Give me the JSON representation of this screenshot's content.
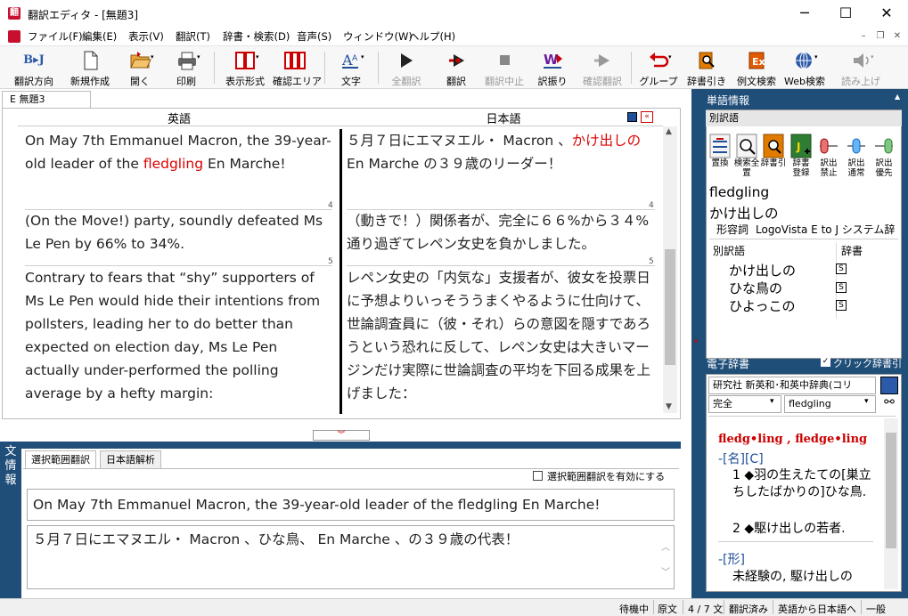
{
  "window": {
    "title": "翻訳エディタ - [無題3]",
    "app_icon_text": "翻"
  },
  "menu": [
    "ファイル(F)",
    "編集(E)",
    "表示(V)",
    "翻訳(T)",
    "辞書・検索(D)",
    "音声(S)",
    "ウィンドウ(W)",
    "ヘルプ(H)"
  ],
  "toolbar": {
    "translate_direction": "翻訳方向",
    "new": "新規作成",
    "open": "開く",
    "print": "印刷",
    "display_format": "表示形式",
    "confirm_area": "確認エリア",
    "characters": "文字",
    "translate_all": "全翻訳",
    "translate": "翻訳",
    "translate_stop": "翻訳中止",
    "furigana": "訳振り",
    "confirm_translate": "確認翻訳",
    "group": "グループ",
    "dict_lookup": "辞書引き",
    "example_search": "例文検索",
    "web_search": "Web検索",
    "read_aloud": "読み上げ",
    "bj_icon": "B▸J"
  },
  "document": {
    "tab_label": "E 無題3",
    "col_english": "英語",
    "col_japanese": "日本語",
    "rows": [
      {
        "en_pre": "On May 7th Emmanuel Macron, the 39-year-old leader of the ",
        "en_hl": "fledgling",
        "en_post": " En Marche!",
        "ja_pre": "５月７日にエマヌエル・ Macron 、",
        "ja_hl": "かけ出しの",
        "ja_post": " En Marche の３９歳のリーダー！",
        "num": "4"
      },
      {
        "en": "(On the Move!) party, soundly defeated Ms Le Pen by 66% to 34%.",
        "ja": "（動きで！）関係者が、完全に６６%から３４%通り過ぎてレペン女史を負かしました。",
        "num": "5"
      },
      {
        "en": "Contrary to fears that “shy” supporters of Ms Le Pen would hide their intentions from pollsters, leading her to do better than expected on election day, Ms Le Pen actually under-performed the polling average by a hefty margin:",
        "ja": "レペン女史の「内気な」支援者が、彼女を投票日に予想よりいっそううまくやるように仕向けて、世論調査員に（彼・それ）らの意図を隠すであろうという恐れに反して、レペン女史は大きいマージンだけ実際に世論調査の平均を下回る成果を上げました：",
        "num": "5"
      }
    ]
  },
  "bottom": {
    "side_label": "文情報",
    "tab_selection": "選択範囲翻訳",
    "tab_japanese": "日本語解析",
    "enable_checkbox": "選択範囲翻訳を有効にする",
    "source": "On May 7th Emmanuel Macron, the 39-year-old leader of the fledgling En Marche!",
    "target": "５月７日にエマヌエル・ Macron 、ひな鳥、 En Marche 、の３９歳の代表！"
  },
  "word_info": {
    "title": "単語情報",
    "section": "別訳語",
    "tools": [
      "置換",
      "検索全置",
      "辞書引",
      "辞書登録",
      "訳出禁止",
      "訳出通常",
      "訳出優先"
    ],
    "headword": "fledgling",
    "translation": "かけ出しの",
    "pos": "形容詞",
    "dict_name": "LogoVista E to J システム辞",
    "table_head_alt": "別訳語",
    "table_head_dict": "辞書",
    "alternatives": [
      "かけ出しの",
      "ひな鳥の",
      "ひよっこの"
    ],
    "dict_badge": "S"
  },
  "e_dict": {
    "title": "電子辞書",
    "checkbox_label": "クリック辞書引",
    "dictionary": "研究社 新英和･和英中辞典(コリ",
    "mode": "完全",
    "query": "fledgling",
    "entry_head": "fledg•ling , fledge•ling",
    "entry_1_tag": "-[名][C]",
    "entry_1_1": "1 ◆羽の生えたての[巣立ちしたばかりの]ひな鳥.",
    "entry_1_2": "2 ◆駆け出しの若者.",
    "entry_2_tag": "-[形]",
    "entry_2_1": "未経験の, 駆け出しの"
  },
  "status": [
    "待機中",
    "原文",
    "4 / 7 文",
    "翻訳済み",
    "英語から日本語へ",
    "一般"
  ]
}
